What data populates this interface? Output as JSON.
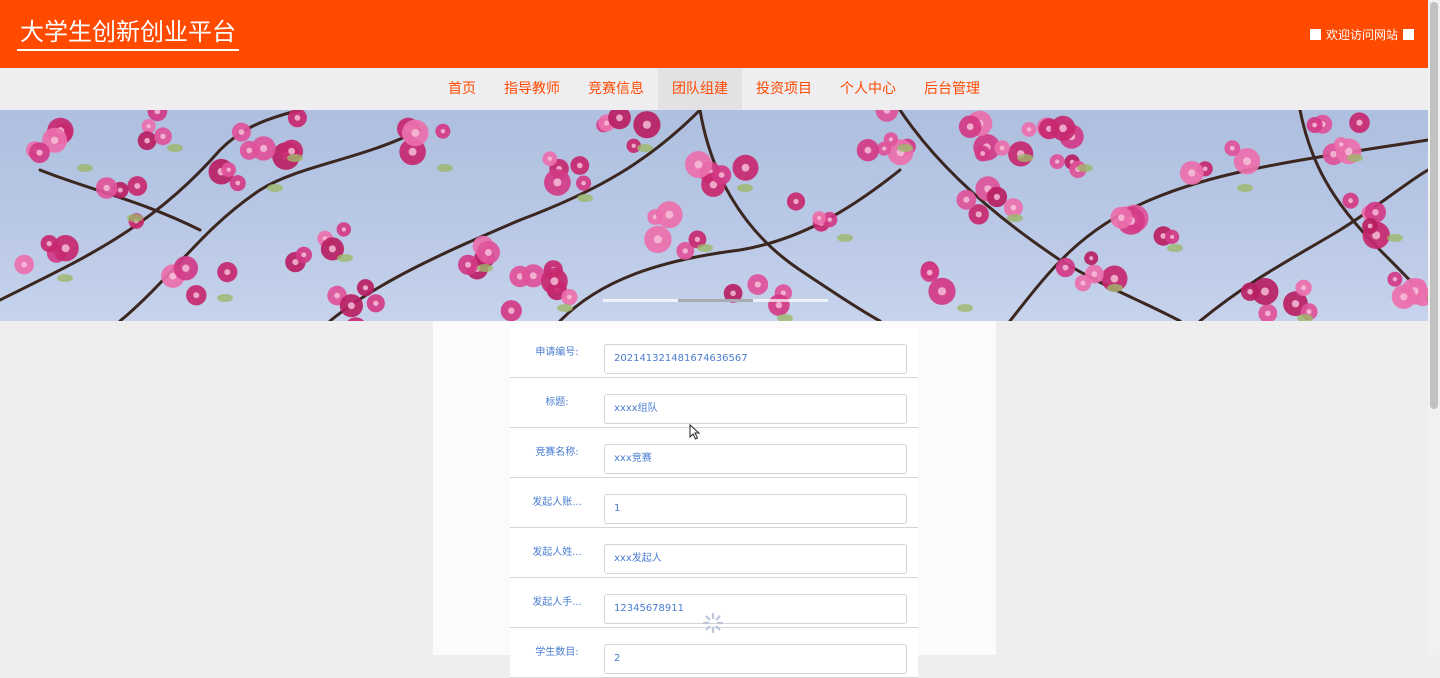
{
  "header": {
    "site_title": "大学生创新创业平台",
    "welcome_text": "欢迎访问网站"
  },
  "nav": {
    "items": [
      {
        "label": "首页",
        "name": "nav-item-home"
      },
      {
        "label": "指导教师",
        "name": "nav-item-teachers"
      },
      {
        "label": "竞赛信息",
        "name": "nav-item-competitions"
      },
      {
        "label": "团队组建",
        "name": "nav-item-team-building"
      },
      {
        "label": "投资项目",
        "name": "nav-item-investment"
      },
      {
        "label": "个人中心",
        "name": "nav-item-profile"
      },
      {
        "label": "后台管理",
        "name": "nav-item-admin"
      }
    ],
    "active_label": "团队组建"
  },
  "form": {
    "fields": [
      {
        "label": "申请编号:",
        "value": "202141321481674636567"
      },
      {
        "label": "标题:",
        "value": "xxxx组队"
      },
      {
        "label": "竞赛名称:",
        "value": "xxx竞赛"
      },
      {
        "label": "发起人账...",
        "value": "1"
      },
      {
        "label": "发起人姓...",
        "value": "xxx发起人"
      },
      {
        "label": "发起人手...",
        "value": "12345678911"
      },
      {
        "label": "学生数目:",
        "value": "2"
      }
    ]
  },
  "colors": {
    "brand": "#ff4a00",
    "label_blue": "#4a7dd0"
  },
  "icons": {
    "loading": "spinner-icon",
    "pointer": "mouse-cursor-icon"
  }
}
